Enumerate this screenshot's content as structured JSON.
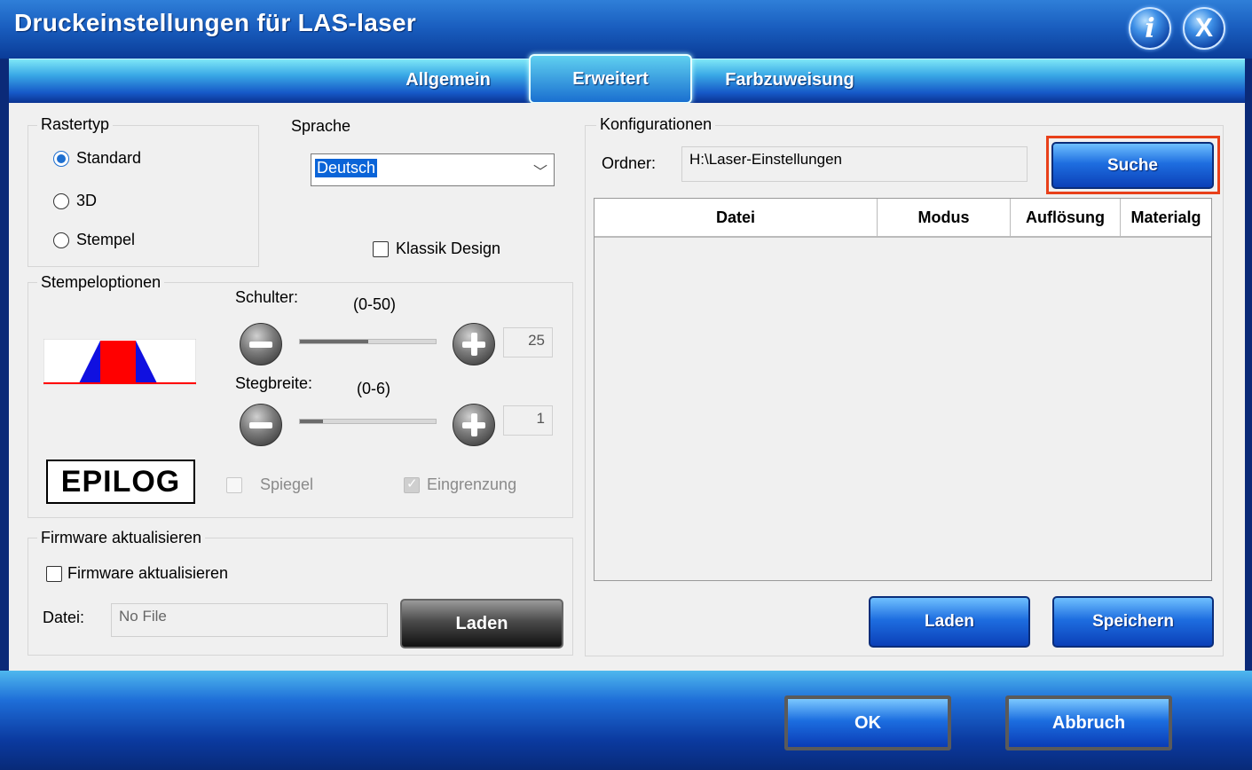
{
  "window": {
    "title": "Druckeinstellungen für LAS-laser",
    "info_icon": "i",
    "close_icon": "X"
  },
  "tabs": [
    {
      "label": "Allgemein"
    },
    {
      "label": "Erweitert",
      "active": true
    },
    {
      "label": "Farbzuweisung"
    }
  ],
  "rastertyp": {
    "label": "Rastertyp",
    "options": [
      {
        "label": "Standard",
        "selected": true
      },
      {
        "label": "3D"
      },
      {
        "label": "Stempel"
      }
    ]
  },
  "sprache": {
    "label": "Sprache",
    "value": "Deutsch"
  },
  "klassik": {
    "label": "Klassik Design",
    "checked": false
  },
  "stempel": {
    "label": "Stempeloptionen",
    "schulter": {
      "label": "Schulter:",
      "range": "(0-50)",
      "value": "25",
      "fraction": 0.5
    },
    "stegbreite": {
      "label": "Stegbreite:",
      "range": "(0-6)",
      "value": "1",
      "fraction": 0.167
    },
    "logo": "EPILOG",
    "spiegel": {
      "label": "Spiegel",
      "checked": false
    },
    "eingrenzung": {
      "label": "Eingrenzung",
      "checked": true
    }
  },
  "firmware": {
    "group_label": "Firmware aktualisieren",
    "checkbox_label": "Firmware aktualisieren",
    "file_label": "Datei:",
    "file_value": "No File",
    "load_button": "Laden"
  },
  "konfig": {
    "label": "Konfigurationen",
    "folder_label": "Ordner:",
    "folder_value": "H:\\Laser-Einstellungen",
    "search_button": "Suche",
    "columns": [
      "Datei",
      "Modus",
      "Auflösung",
      "Materialg"
    ],
    "load_button": "Laden",
    "save_button": "Speichern"
  },
  "footer": {
    "ok": "OK",
    "cancel": "Abbruch"
  },
  "colors": {
    "accent": "#1e6ee0",
    "highlight": "#e8401a"
  }
}
